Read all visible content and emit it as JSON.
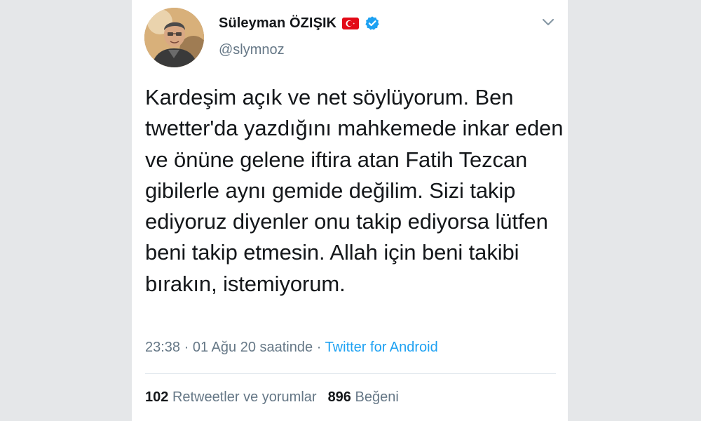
{
  "tweet": {
    "author": {
      "name": "Süleyman ÖZIŞIK",
      "handle": "@slymnoz"
    },
    "text": "Kardeşim açık ve net söylüyorum. Ben twetter'da yazdığını mahkemede inkar eden ve önüne gelene iftira atan Fatih Tezcan gibilerle aynı gemide değilim. Sizi takip ediyoruz diyenler onu takip ediyorsa lütfen beni takip etmesin. Allah için beni takibi bırakın, istemiyorum.",
    "time": "23:38",
    "date": "01 Ağu 20 saatinde",
    "separator": "·",
    "source": "Twitter for Android",
    "retweets_count": "102",
    "retweets_label": "Retweetler ve yorumlar",
    "likes_count": "896",
    "likes_label": "Beğeni"
  },
  "icons": {
    "flag": "turkey-flag-icon",
    "verified": "verified-badge-icon",
    "menu": "chevron-down-icon"
  },
  "colors": {
    "text": "#14171a",
    "secondary": "#657786",
    "link": "#1da1f2",
    "verified": "#1da1f2",
    "flag_red": "#e30a17"
  }
}
